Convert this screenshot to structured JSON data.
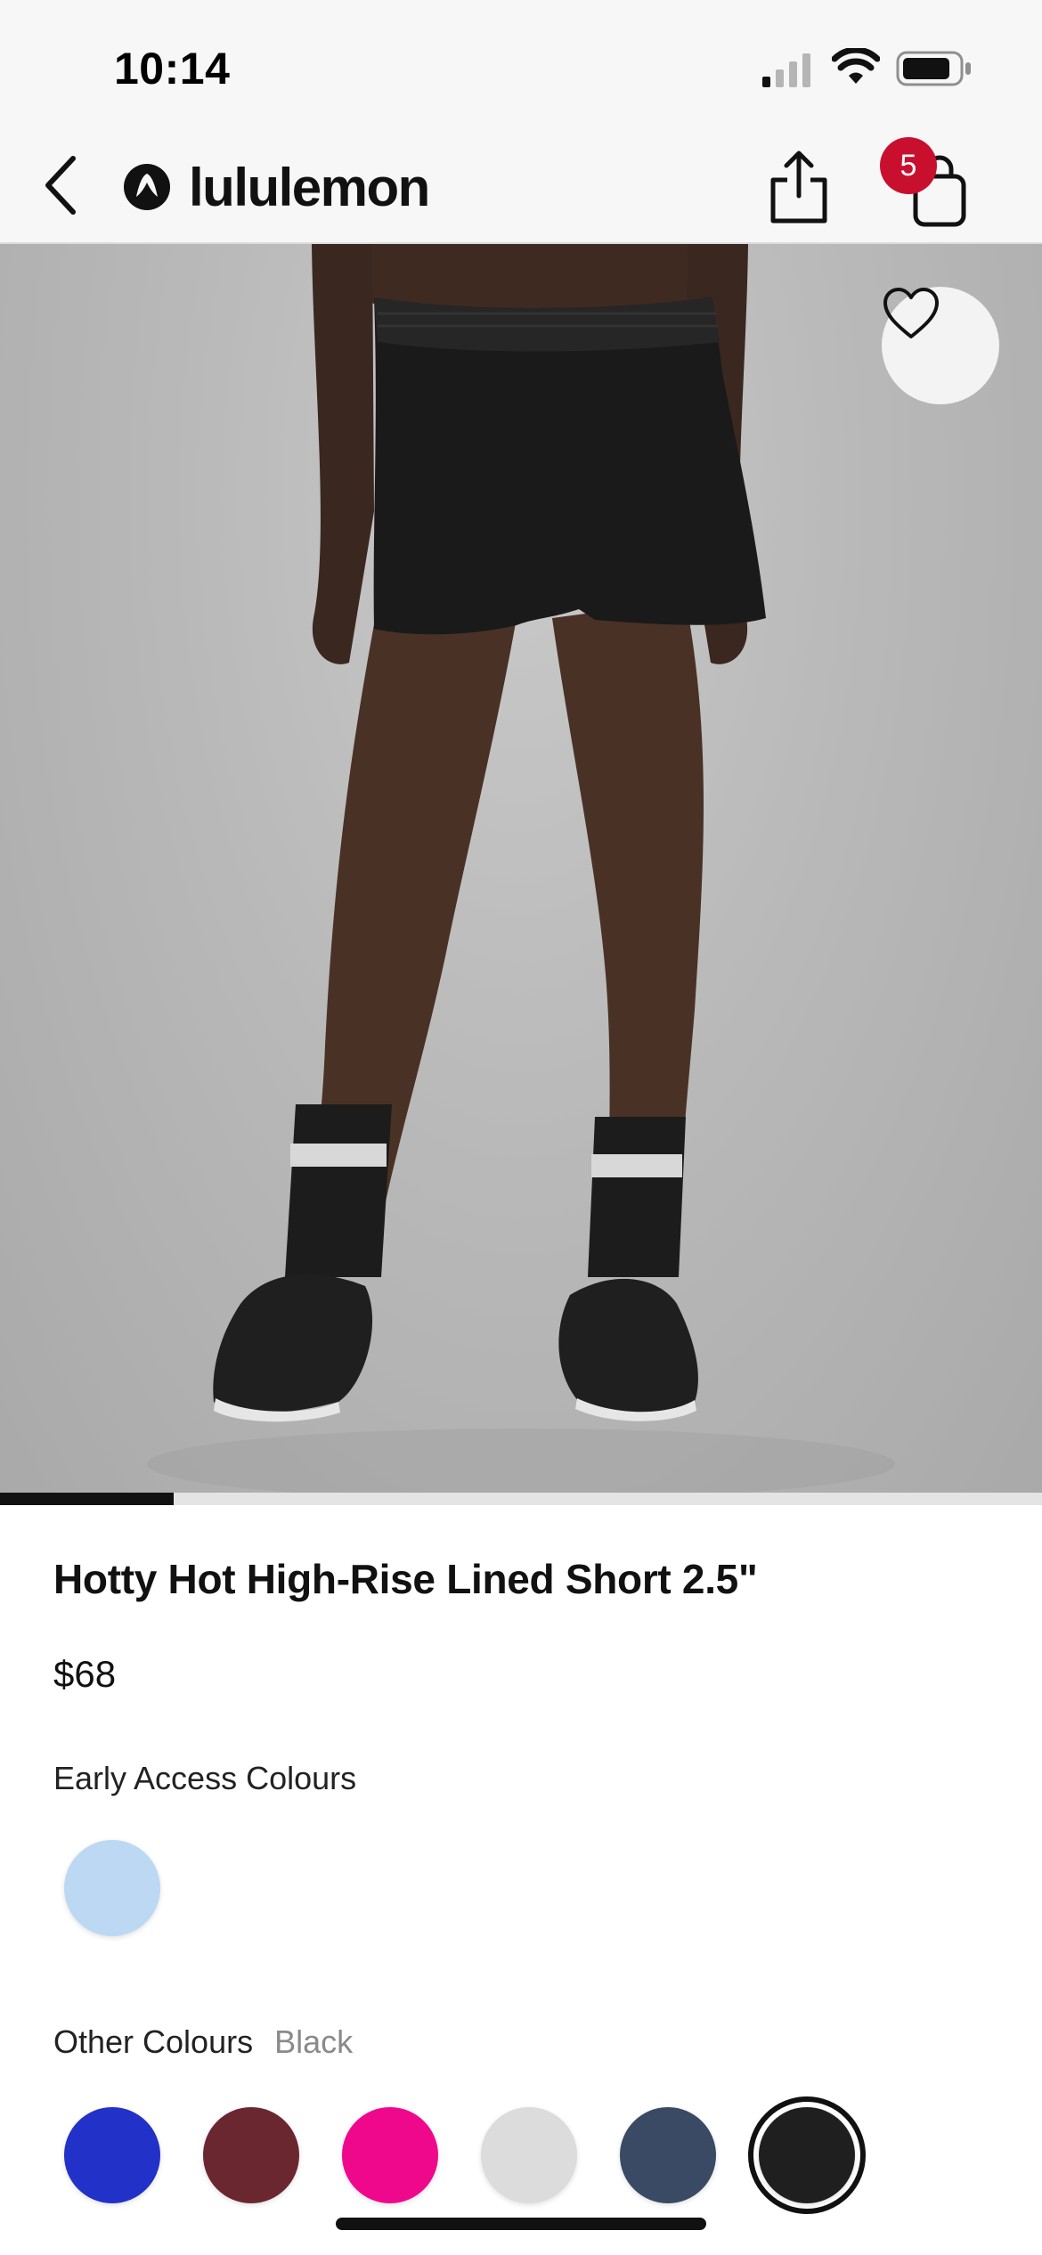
{
  "status_bar": {
    "time": "10:14"
  },
  "nav": {
    "brand_name": "lululemon",
    "cart_count": "5",
    "icons": [
      "back-chevron-icon",
      "lululemon-logo-icon",
      "share-icon",
      "shopping-bag-icon"
    ]
  },
  "product": {
    "image_icon": "heart-icon",
    "image_progress": 0.167,
    "title": "Hotty Hot High-Rise Lined Short 2.5\"",
    "price": "$68",
    "early_access_label": "Early Access Colours",
    "early_access_colours": [
      "#bcd8f3"
    ],
    "other_colours_label": "Other Colours",
    "selected_colour_name": "Black",
    "other_colours": [
      "#2231c7",
      "#6b2730",
      "#f0088c",
      "#dcdcdc",
      "#3a4a64",
      "#1f1f1f"
    ]
  },
  "colors": {
    "badge": "#c8102e",
    "text": "#111111",
    "muted_text": "#8a8a8a"
  }
}
